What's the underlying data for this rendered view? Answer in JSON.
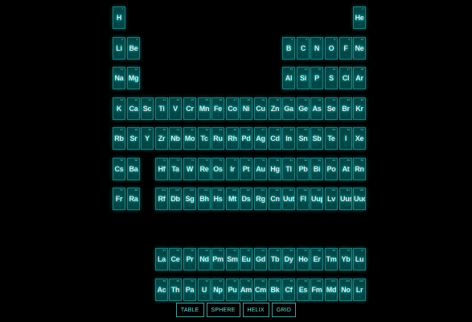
{
  "menu": {
    "buttons": [
      "TABLE",
      "SPHERE",
      "HELIX",
      "GRID"
    ]
  },
  "colors": {
    "background": "#000000",
    "tile": "#007f7f",
    "tile_border": "#7fffff",
    "glow": "#00ffff"
  },
  "elements": [
    {
      "symbol": "H",
      "number": 1,
      "col": 1,
      "row": 1
    },
    {
      "symbol": "He",
      "number": 2,
      "col": 18,
      "row": 1
    },
    {
      "symbol": "Li",
      "number": 3,
      "col": 1,
      "row": 2
    },
    {
      "symbol": "Be",
      "number": 4,
      "col": 2,
      "row": 2
    },
    {
      "symbol": "B",
      "number": 5,
      "col": 13,
      "row": 2
    },
    {
      "symbol": "C",
      "number": 6,
      "col": 14,
      "row": 2
    },
    {
      "symbol": "N",
      "number": 7,
      "col": 15,
      "row": 2
    },
    {
      "symbol": "O",
      "number": 8,
      "col": 16,
      "row": 2
    },
    {
      "symbol": "F",
      "number": 9,
      "col": 17,
      "row": 2
    },
    {
      "symbol": "Ne",
      "number": 10,
      "col": 18,
      "row": 2
    },
    {
      "symbol": "Na",
      "number": 11,
      "col": 1,
      "row": 3
    },
    {
      "symbol": "Mg",
      "number": 12,
      "col": 2,
      "row": 3
    },
    {
      "symbol": "Al",
      "number": 13,
      "col": 13,
      "row": 3
    },
    {
      "symbol": "Si",
      "number": 14,
      "col": 14,
      "row": 3
    },
    {
      "symbol": "P",
      "number": 15,
      "col": 15,
      "row": 3
    },
    {
      "symbol": "S",
      "number": 16,
      "col": 16,
      "row": 3
    },
    {
      "symbol": "Cl",
      "number": 17,
      "col": 17,
      "row": 3
    },
    {
      "symbol": "Ar",
      "number": 18,
      "col": 18,
      "row": 3
    },
    {
      "symbol": "K",
      "number": 19,
      "col": 1,
      "row": 4
    },
    {
      "symbol": "Ca",
      "number": 20,
      "col": 2,
      "row": 4
    },
    {
      "symbol": "Sc",
      "number": 21,
      "col": 3,
      "row": 4
    },
    {
      "symbol": "Ti",
      "number": 22,
      "col": 4,
      "row": 4
    },
    {
      "symbol": "V",
      "number": 23,
      "col": 5,
      "row": 4
    },
    {
      "symbol": "Cr",
      "number": 24,
      "col": 6,
      "row": 4
    },
    {
      "symbol": "Mn",
      "number": 25,
      "col": 7,
      "row": 4
    },
    {
      "symbol": "Fe",
      "number": 26,
      "col": 8,
      "row": 4
    },
    {
      "symbol": "Co",
      "number": 27,
      "col": 9,
      "row": 4
    },
    {
      "symbol": "Ni",
      "number": 28,
      "col": 10,
      "row": 4
    },
    {
      "symbol": "Cu",
      "number": 29,
      "col": 11,
      "row": 4
    },
    {
      "symbol": "Zn",
      "number": 30,
      "col": 12,
      "row": 4
    },
    {
      "symbol": "Ga",
      "number": 31,
      "col": 13,
      "row": 4
    },
    {
      "symbol": "Ge",
      "number": 32,
      "col": 14,
      "row": 4
    },
    {
      "symbol": "As",
      "number": 33,
      "col": 15,
      "row": 4
    },
    {
      "symbol": "Se",
      "number": 34,
      "col": 16,
      "row": 4
    },
    {
      "symbol": "Br",
      "number": 35,
      "col": 17,
      "row": 4
    },
    {
      "symbol": "Kr",
      "number": 36,
      "col": 18,
      "row": 4
    },
    {
      "symbol": "Rb",
      "number": 37,
      "col": 1,
      "row": 5
    },
    {
      "symbol": "Sr",
      "number": 38,
      "col": 2,
      "row": 5
    },
    {
      "symbol": "Y",
      "number": 39,
      "col": 3,
      "row": 5
    },
    {
      "symbol": "Zr",
      "number": 40,
      "col": 4,
      "row": 5
    },
    {
      "symbol": "Nb",
      "number": 41,
      "col": 5,
      "row": 5
    },
    {
      "symbol": "Mo",
      "number": 42,
      "col": 6,
      "row": 5
    },
    {
      "symbol": "Tc",
      "number": 43,
      "col": 7,
      "row": 5
    },
    {
      "symbol": "Ru",
      "number": 44,
      "col": 8,
      "row": 5
    },
    {
      "symbol": "Rh",
      "number": 45,
      "col": 9,
      "row": 5
    },
    {
      "symbol": "Pd",
      "number": 46,
      "col": 10,
      "row": 5
    },
    {
      "symbol": "Ag",
      "number": 47,
      "col": 11,
      "row": 5
    },
    {
      "symbol": "Cd",
      "number": 48,
      "col": 12,
      "row": 5
    },
    {
      "symbol": "In",
      "number": 49,
      "col": 13,
      "row": 5
    },
    {
      "symbol": "Sn",
      "number": 50,
      "col": 14,
      "row": 5
    },
    {
      "symbol": "Sb",
      "number": 51,
      "col": 15,
      "row": 5
    },
    {
      "symbol": "Te",
      "number": 52,
      "col": 16,
      "row": 5
    },
    {
      "symbol": "I",
      "number": 53,
      "col": 17,
      "row": 5
    },
    {
      "symbol": "Xe",
      "number": 54,
      "col": 18,
      "row": 5
    },
    {
      "symbol": "Cs",
      "number": 55,
      "col": 1,
      "row": 6
    },
    {
      "symbol": "Ba",
      "number": 56,
      "col": 2,
      "row": 6
    },
    {
      "symbol": "Hf",
      "number": 72,
      "col": 4,
      "row": 6
    },
    {
      "symbol": "Ta",
      "number": 73,
      "col": 5,
      "row": 6
    },
    {
      "symbol": "W",
      "number": 74,
      "col": 6,
      "row": 6
    },
    {
      "symbol": "Re",
      "number": 75,
      "col": 7,
      "row": 6
    },
    {
      "symbol": "Os",
      "number": 76,
      "col": 8,
      "row": 6
    },
    {
      "symbol": "Ir",
      "number": 77,
      "col": 9,
      "row": 6
    },
    {
      "symbol": "Pt",
      "number": 78,
      "col": 10,
      "row": 6
    },
    {
      "symbol": "Au",
      "number": 79,
      "col": 11,
      "row": 6
    },
    {
      "symbol": "Hg",
      "number": 80,
      "col": 12,
      "row": 6
    },
    {
      "symbol": "Tl",
      "number": 81,
      "col": 13,
      "row": 6
    },
    {
      "symbol": "Pb",
      "number": 82,
      "col": 14,
      "row": 6
    },
    {
      "symbol": "Bi",
      "number": 83,
      "col": 15,
      "row": 6
    },
    {
      "symbol": "Po",
      "number": 84,
      "col": 16,
      "row": 6
    },
    {
      "symbol": "At",
      "number": 85,
      "col": 17,
      "row": 6
    },
    {
      "symbol": "Rn",
      "number": 86,
      "col": 18,
      "row": 6
    },
    {
      "symbol": "Fr",
      "number": 87,
      "col": 1,
      "row": 7
    },
    {
      "symbol": "Ra",
      "number": 88,
      "col": 2,
      "row": 7
    },
    {
      "symbol": "Rf",
      "number": 104,
      "col": 4,
      "row": 7
    },
    {
      "symbol": "Db",
      "number": 105,
      "col": 5,
      "row": 7
    },
    {
      "symbol": "Sg",
      "number": 106,
      "col": 6,
      "row": 7
    },
    {
      "symbol": "Bh",
      "number": 107,
      "col": 7,
      "row": 7
    },
    {
      "symbol": "Hs",
      "number": 108,
      "col": 8,
      "row": 7
    },
    {
      "symbol": "Mt",
      "number": 109,
      "col": 9,
      "row": 7
    },
    {
      "symbol": "Ds",
      "number": 110,
      "col": 10,
      "row": 7
    },
    {
      "symbol": "Rg",
      "number": 111,
      "col": 11,
      "row": 7
    },
    {
      "symbol": "Cn",
      "number": 112,
      "col": 12,
      "row": 7
    },
    {
      "symbol": "Uut",
      "number": 113,
      "col": 13,
      "row": 7
    },
    {
      "symbol": "Fl",
      "number": 114,
      "col": 14,
      "row": 7
    },
    {
      "symbol": "Uup",
      "number": 115,
      "col": 15,
      "row": 7
    },
    {
      "symbol": "Lv",
      "number": 116,
      "col": 16,
      "row": 7
    },
    {
      "symbol": "Uus",
      "number": 117,
      "col": 17,
      "row": 7
    },
    {
      "symbol": "Uuo",
      "number": 118,
      "col": 18,
      "row": 7
    },
    {
      "symbol": "La",
      "number": 57,
      "col": 4,
      "row": 9
    },
    {
      "symbol": "Ce",
      "number": 58,
      "col": 5,
      "row": 9
    },
    {
      "symbol": "Pr",
      "number": 59,
      "col": 6,
      "row": 9
    },
    {
      "symbol": "Nd",
      "number": 60,
      "col": 7,
      "row": 9
    },
    {
      "symbol": "Pm",
      "number": 61,
      "col": 8,
      "row": 9
    },
    {
      "symbol": "Sm",
      "number": 62,
      "col": 9,
      "row": 9
    },
    {
      "symbol": "Eu",
      "number": 63,
      "col": 10,
      "row": 9
    },
    {
      "symbol": "Gd",
      "number": 64,
      "col": 11,
      "row": 9
    },
    {
      "symbol": "Tb",
      "number": 65,
      "col": 12,
      "row": 9
    },
    {
      "symbol": "Dy",
      "number": 66,
      "col": 13,
      "row": 9
    },
    {
      "symbol": "Ho",
      "number": 67,
      "col": 14,
      "row": 9
    },
    {
      "symbol": "Er",
      "number": 68,
      "col": 15,
      "row": 9
    },
    {
      "symbol": "Tm",
      "number": 69,
      "col": 16,
      "row": 9
    },
    {
      "symbol": "Yb",
      "number": 70,
      "col": 17,
      "row": 9
    },
    {
      "symbol": "Lu",
      "number": 71,
      "col": 18,
      "row": 9
    },
    {
      "symbol": "Ac",
      "number": 89,
      "col": 4,
      "row": 10
    },
    {
      "symbol": "Th",
      "number": 90,
      "col": 5,
      "row": 10
    },
    {
      "symbol": "Pa",
      "number": 91,
      "col": 6,
      "row": 10
    },
    {
      "symbol": "U",
      "number": 92,
      "col": 7,
      "row": 10
    },
    {
      "symbol": "Np",
      "number": 93,
      "col": 8,
      "row": 10
    },
    {
      "symbol": "Pu",
      "number": 94,
      "col": 9,
      "row": 10
    },
    {
      "symbol": "Am",
      "number": 95,
      "col": 10,
      "row": 10
    },
    {
      "symbol": "Cm",
      "number": 96,
      "col": 11,
      "row": 10
    },
    {
      "symbol": "Bk",
      "number": 97,
      "col": 12,
      "row": 10
    },
    {
      "symbol": "Cf",
      "number": 98,
      "col": 13,
      "row": 10
    },
    {
      "symbol": "Es",
      "number": 99,
      "col": 14,
      "row": 10
    },
    {
      "symbol": "Fm",
      "number": 100,
      "col": 15,
      "row": 10
    },
    {
      "symbol": "Md",
      "number": 101,
      "col": 16,
      "row": 10
    },
    {
      "symbol": "No",
      "number": 102,
      "col": 17,
      "row": 10
    },
    {
      "symbol": "Lr",
      "number": 103,
      "col": 18,
      "row": 10
    }
  ]
}
